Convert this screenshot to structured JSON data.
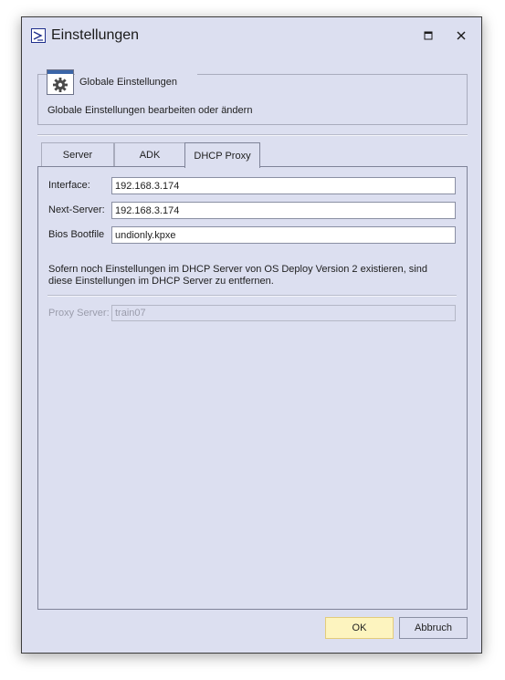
{
  "window": {
    "title": "Einstellungen"
  },
  "header": {
    "title": "Globale Einstellungen",
    "description": "Globale Einstellungen bearbeiten oder ändern"
  },
  "tabs": [
    {
      "label": "Server"
    },
    {
      "label": "ADK"
    },
    {
      "label": "DHCP Proxy",
      "active": true
    }
  ],
  "dhcp_proxy": {
    "interface_label": "Interface:",
    "interface_value": "192.168.3.174",
    "next_server_label": "Next-Server:",
    "next_server_value": "192.168.3.174",
    "bios_bootfile_label": "Bios Bootfile",
    "bios_bootfile_value": "undionly.kpxe",
    "info_text": "Sofern noch Einstellungen im DHCP Server von OS Deploy Version 2 existieren, sind diese Einstellungen im DHCP Server zu entfernen.",
    "proxy_server_label": "Proxy Server:",
    "proxy_server_value": "train07"
  },
  "buttons": {
    "ok": "OK",
    "cancel": "Abbruch"
  },
  "colors": {
    "window_bg": "#dcdff0",
    "ok_bg": "#fdf4bf",
    "accent": "#3b65a8"
  },
  "icons": {
    "app": "terminal-icon",
    "header": "gear-icon",
    "maximize": "maximize-icon",
    "close": "close-icon"
  }
}
